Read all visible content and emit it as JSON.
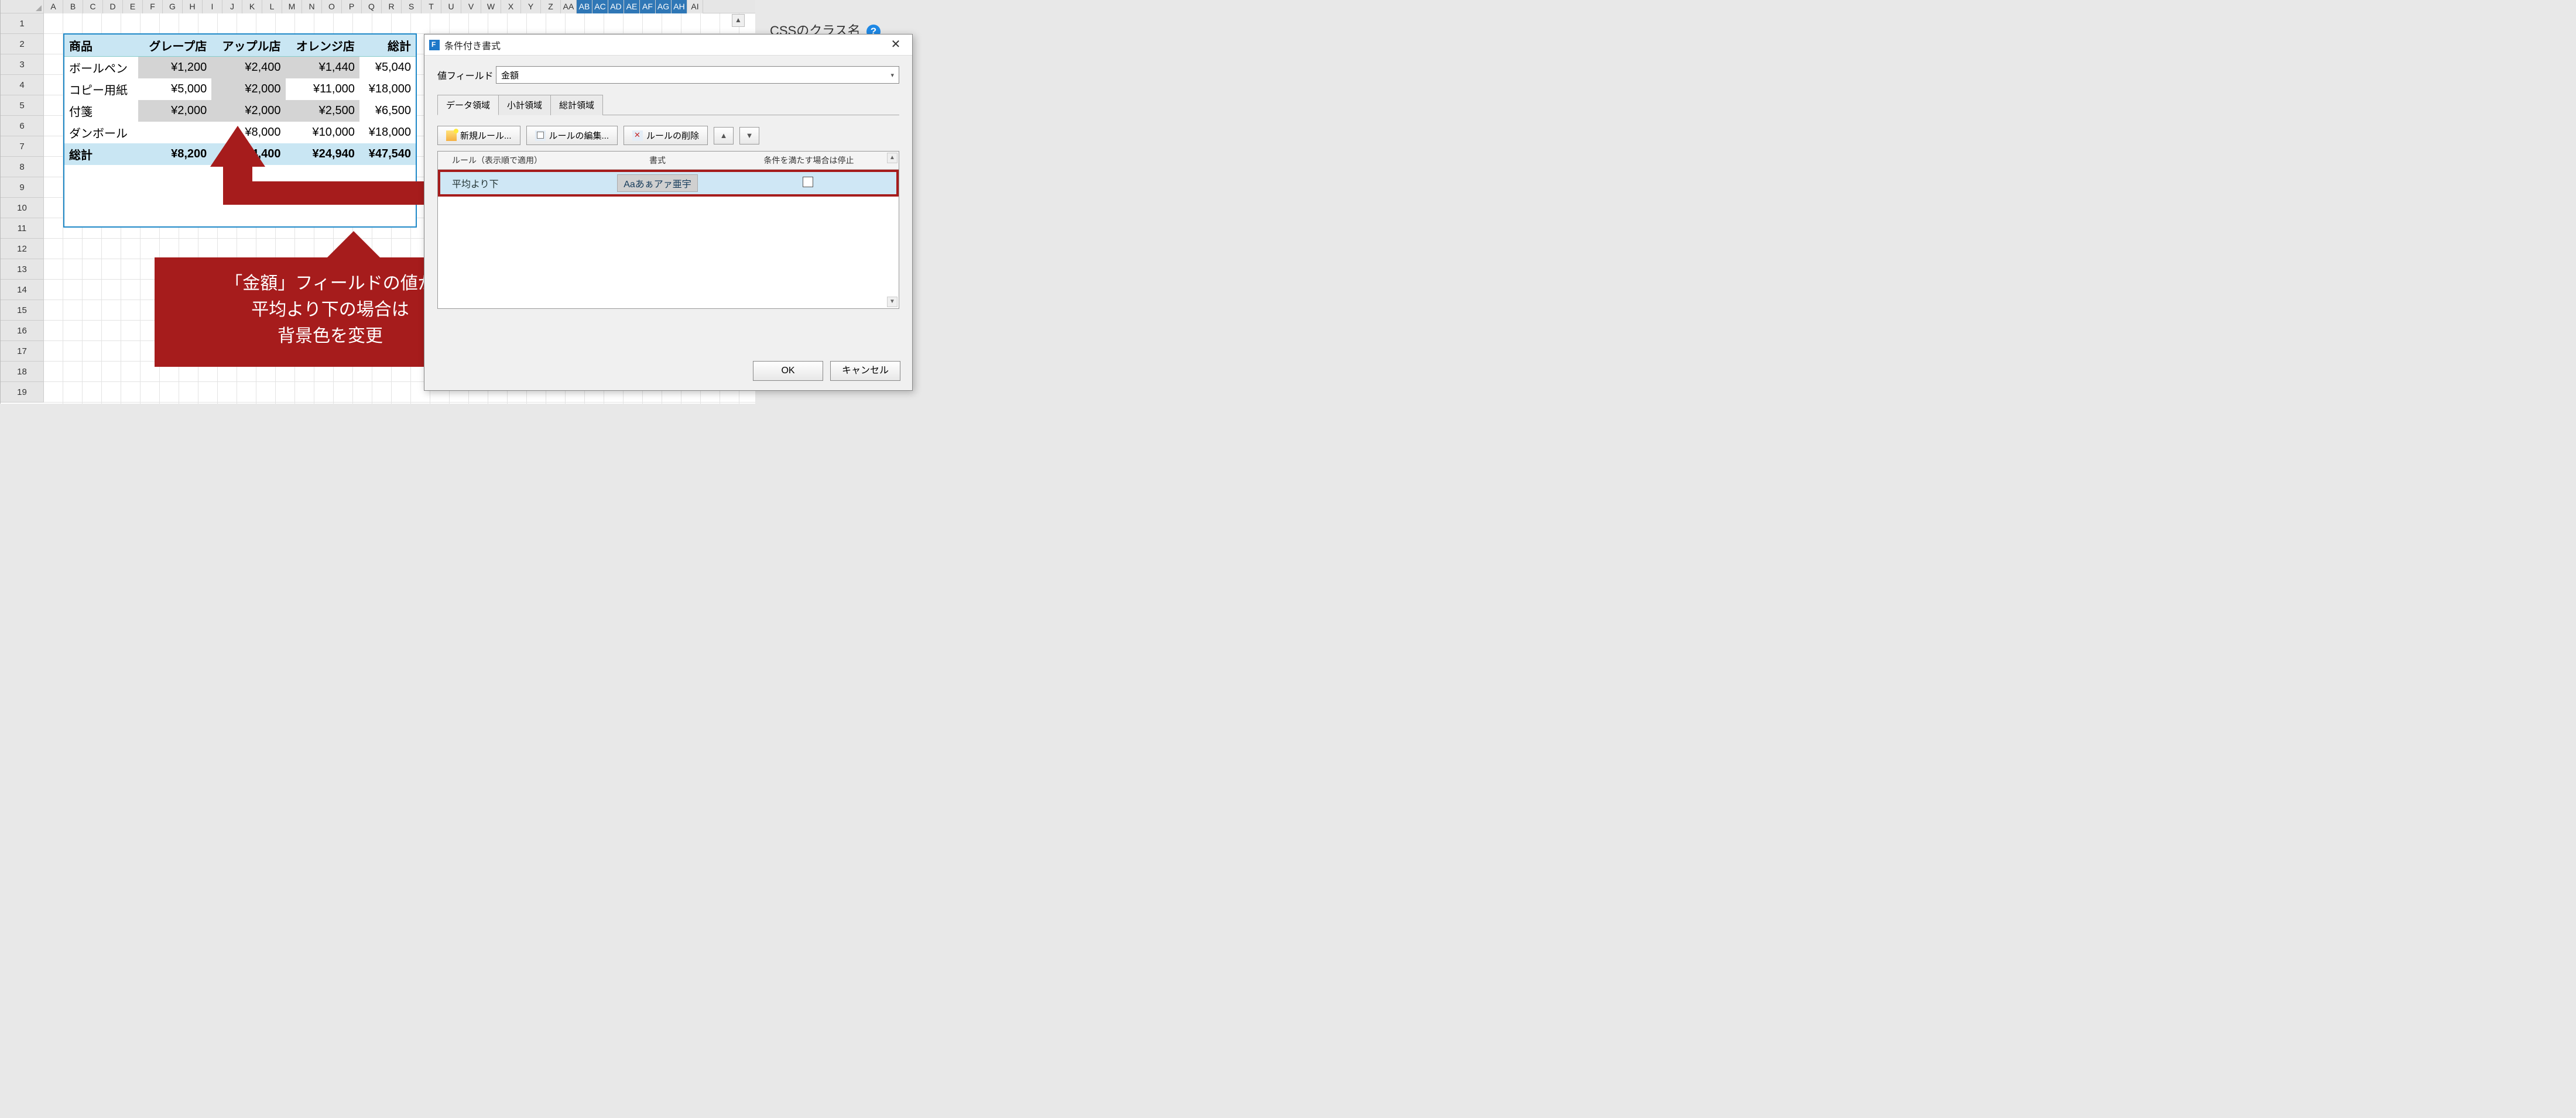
{
  "spreadsheet": {
    "row_count": 19,
    "columns": [
      "A",
      "B",
      "C",
      "D",
      "E",
      "F",
      "G",
      "H",
      "I",
      "J",
      "K",
      "L",
      "M",
      "N",
      "O",
      "P",
      "Q",
      "R",
      "S",
      "T",
      "U",
      "V",
      "W",
      "X",
      "Y",
      "Z",
      "AA",
      "AB",
      "AC",
      "AD",
      "AE",
      "AF",
      "AG",
      "AH",
      "AI"
    ],
    "selected_cols": [
      "AB",
      "AC",
      "AD",
      "AE",
      "AF",
      "AG",
      "AH"
    ]
  },
  "pivot": {
    "headers": [
      "商品",
      "グレープ店",
      "アップル店",
      "オレンジ店",
      "総計"
    ],
    "rows": [
      {
        "label": "ボールペン",
        "v": [
          "¥1,200",
          "¥2,400",
          "¥1,440",
          "¥5,040"
        ],
        "shade": [
          true,
          true,
          true,
          false
        ]
      },
      {
        "label": "コピー用紙",
        "v": [
          "¥5,000",
          "¥2,000",
          "¥11,000",
          "¥18,000"
        ],
        "shade": [
          false,
          true,
          false,
          false
        ]
      },
      {
        "label": "付箋",
        "v": [
          "¥2,000",
          "¥2,000",
          "¥2,500",
          "¥6,500"
        ],
        "shade": [
          true,
          true,
          true,
          false
        ]
      },
      {
        "label": "ダンボール",
        "v": [
          "",
          "¥8,000",
          "¥10,000",
          "¥18,000"
        ],
        "shade": [
          false,
          false,
          false,
          false
        ]
      }
    ],
    "total": {
      "label": "総計",
      "v": [
        "¥8,200",
        "¥14,400",
        "¥24,940",
        "¥47,540"
      ]
    }
  },
  "callout": {
    "line1": "「金額」フィールドの値が",
    "line2": "平均より下の場合は",
    "line3": "背景色を変更"
  },
  "right_panel": {
    "label": "CSSのクラス名"
  },
  "dialog": {
    "title": "条件付き書式",
    "value_field_label": "値フィールド",
    "value_field_value": "金額",
    "tabs": [
      "データ領域",
      "小計領域",
      "総計領域"
    ],
    "active_tab": 0,
    "buttons": {
      "new": "新規ルール...",
      "edit": "ルールの編集...",
      "delete": "ルールの削除"
    },
    "rule_headers": {
      "c1": "ルール（表示順で適用）",
      "c2": "書式",
      "c3": "条件を満たす場合は停止"
    },
    "rule": {
      "name": "平均より下",
      "sample": "Aaあぁアァ亜宇",
      "stop": false
    },
    "ok": "OK",
    "cancel": "キャンセル"
  }
}
